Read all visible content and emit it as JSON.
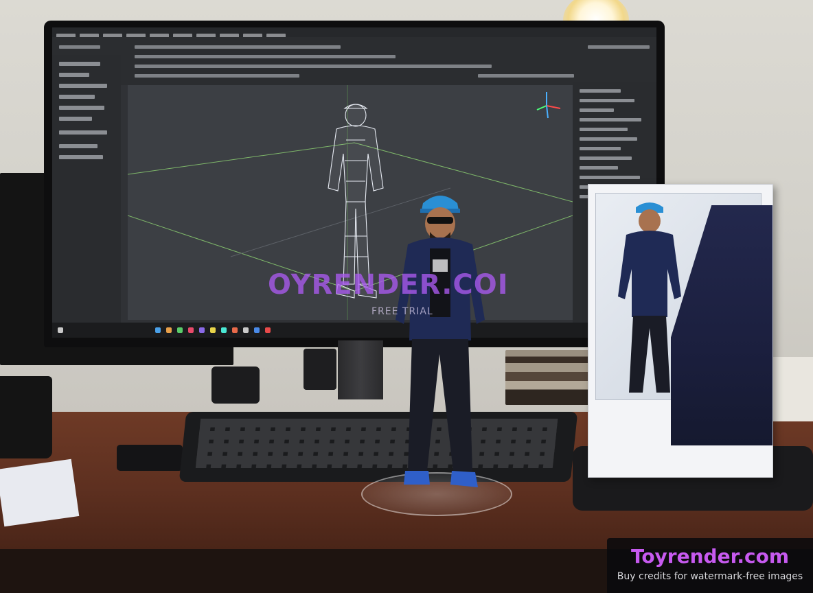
{
  "watermark": {
    "main_text": "OYRENDER.COI",
    "sub_text": "FREE TRIAL"
  },
  "badge": {
    "title": "Toyrender.com",
    "subtitle": "Buy credits for watermark-free images"
  },
  "colors": {
    "watermark_purple": "#a85af0",
    "badge_title": "#c75af0",
    "desk_wood": "#6e3a26",
    "wall": "#dcdad3",
    "jacket_navy": "#1f2a55",
    "cap_blue": "#2a8fd4"
  }
}
